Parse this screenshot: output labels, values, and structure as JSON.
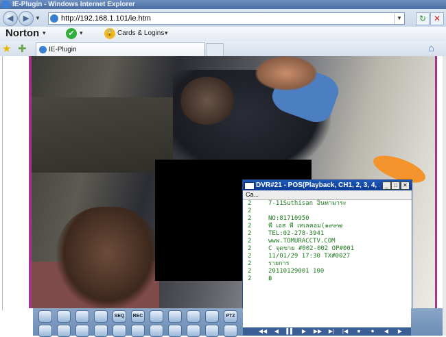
{
  "window": {
    "title": "IE-Plugin - Windows Internet Explorer"
  },
  "address_bar": {
    "url": "http://192.168.1.101/ie.htm",
    "dropdown_icon": "chevron-down-icon"
  },
  "nav": {
    "back_icon": "back-arrow-icon",
    "forward_icon": "forward-arrow-icon",
    "refresh_icon": "refresh-icon",
    "stop_icon": "stop-icon"
  },
  "toolbar": {
    "norton_label": "Norton",
    "cards_label": "Cards & Logins"
  },
  "tab": {
    "label": "IE-Plugin"
  },
  "pos_window": {
    "title": "DVR#21 - POS(Playback, CH1, 2, 3, 4, ...",
    "menu_label": "Ca...",
    "minimize_glyph": "_",
    "maximize_glyph": "□",
    "close_glyph": "✕",
    "lines": [
      {
        "ch": "2",
        "text": "7-11Suthisan อินทามาระ"
      },
      {
        "ch": "2",
        "text": ""
      },
      {
        "ch": "2",
        "text": "      NO:81710950"
      },
      {
        "ch": "2",
        "text": "พี เอส พี เทเลคอม(๑๙๙๗"
      },
      {
        "ch": "2",
        "text": "      TEL:02-278-3941"
      },
      {
        "ch": "2",
        "text": "www.TOMURACCTV.COM"
      },
      {
        "ch": "2",
        "text": "C จุดขาย #002-002   OP#001"
      },
      {
        "ch": "2",
        "text": "11/01/29 17:30   TX#0027"
      },
      {
        "ch": "2",
        "text": "รายการ"
      },
      {
        "ch": "2",
        "text": "20110129001          100"
      },
      {
        "ch": "2",
        "text": "฿"
      }
    ]
  },
  "player_toolbar": {
    "row1": [
      "",
      "",
      "",
      "",
      "SEQ",
      "REC",
      "",
      "",
      "",
      "",
      "PTZ"
    ],
    "row2": [
      "",
      "",
      "",
      "",
      "",
      "",
      "",
      "",
      "",
      "",
      ""
    ]
  },
  "colors": {
    "pos_text": "#1e7a1e",
    "title_blue": "#0c3c93",
    "frame_pink": "#a4348c"
  }
}
